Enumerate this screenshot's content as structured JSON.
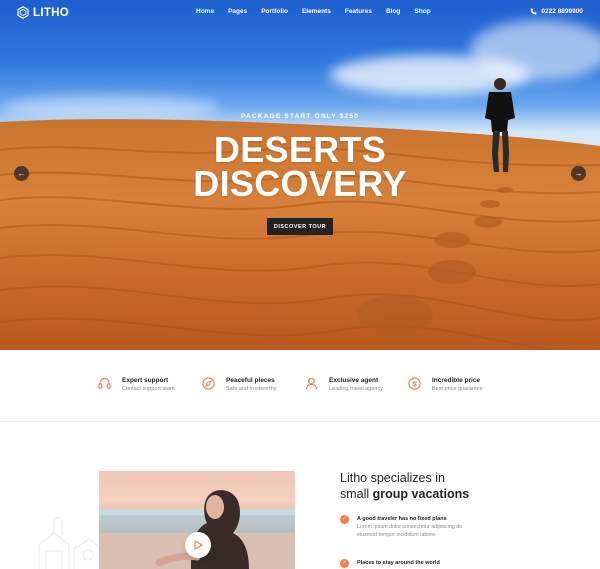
{
  "brand": {
    "name": "LITHO"
  },
  "nav": {
    "items": [
      "Home",
      "Pages",
      "Portfolio",
      "Elements",
      "Features",
      "Blog",
      "Shop"
    ],
    "phone": "0222 8899900"
  },
  "hero": {
    "kicker": "PACKAGE START ONLY $250",
    "title_line1": "DESERTS",
    "title_line2": "DISCOVERY",
    "cta": "DISCOVER TOUR"
  },
  "features": [
    {
      "title": "Expert support",
      "sub": "Contact support team",
      "icon": "headset-icon"
    },
    {
      "title": "Peaceful pleces",
      "sub": "Safe and trustworthy",
      "icon": "compass-icon"
    },
    {
      "title": "Exclusive agent",
      "sub": "Leading travel agency",
      "icon": "user-icon"
    },
    {
      "title": "Incredible price",
      "sub": "Best price guarantee",
      "icon": "dollar-icon"
    }
  ],
  "about": {
    "title_part1": "Litho specializes in",
    "title_part2": "small",
    "title_bold": "group vacations",
    "bullets": [
      {
        "title": "A good traveler has no fixed plans",
        "text": "Lorem ipsum dolor consectetur adipiscing do eiusmod tempor incididunt labore."
      },
      {
        "title": "Places to stay around the world",
        "text": ""
      }
    ]
  },
  "colors": {
    "accent": "#f47c45",
    "dark": "#232323"
  }
}
